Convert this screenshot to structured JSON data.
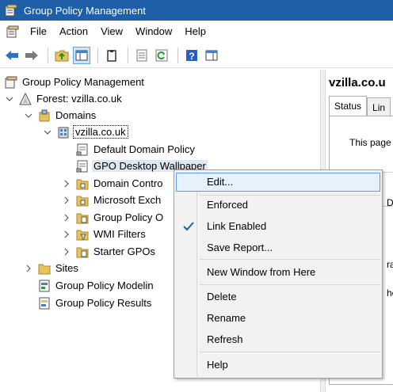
{
  "window": {
    "title": "Group Policy Management"
  },
  "menu": [
    "File",
    "Action",
    "View",
    "Window",
    "Help"
  ],
  "toolbar": [
    "back-icon",
    "forward-icon",
    "up-folder-icon",
    "show-hide-tree-icon",
    "clipboard-icon",
    "properties-icon",
    "refresh-icon",
    "help-icon",
    "show-action-pane-icon"
  ],
  "tree": {
    "root": "Group Policy Management",
    "forest": "Forest: vzilla.co.uk",
    "domains": "Domains",
    "domain": "vzilla.co.uk",
    "default_policy": "Default Domain Policy",
    "gpo": "GPO Desktop Wallpaper",
    "domain_controllers": "Domain Contro",
    "microsoft_exch": "Microsoft Exch",
    "group_policy_o": "Group Policy O",
    "wmi_filters": "WMI Filters",
    "starter_gpos": "Starter GPOs",
    "sites": "Sites",
    "modeling": "Group Policy Modelin",
    "results": "Group Policy Results"
  },
  "right_pane": {
    "title": "vzilla.co.u",
    "tab_status": "Status",
    "tab_link": "Lin",
    "text_this_page": "This page",
    "text_de": "De",
    "text_ras": "ras",
    "text_he": "he"
  },
  "context_menu": {
    "edit": "Edit...",
    "enforced": "Enforced",
    "link_enabled": "Link Enabled",
    "save_report": "Save Report...",
    "new_window": "New Window from Here",
    "delete": "Delete",
    "rename": "Rename",
    "refresh": "Refresh",
    "help": "Help"
  }
}
